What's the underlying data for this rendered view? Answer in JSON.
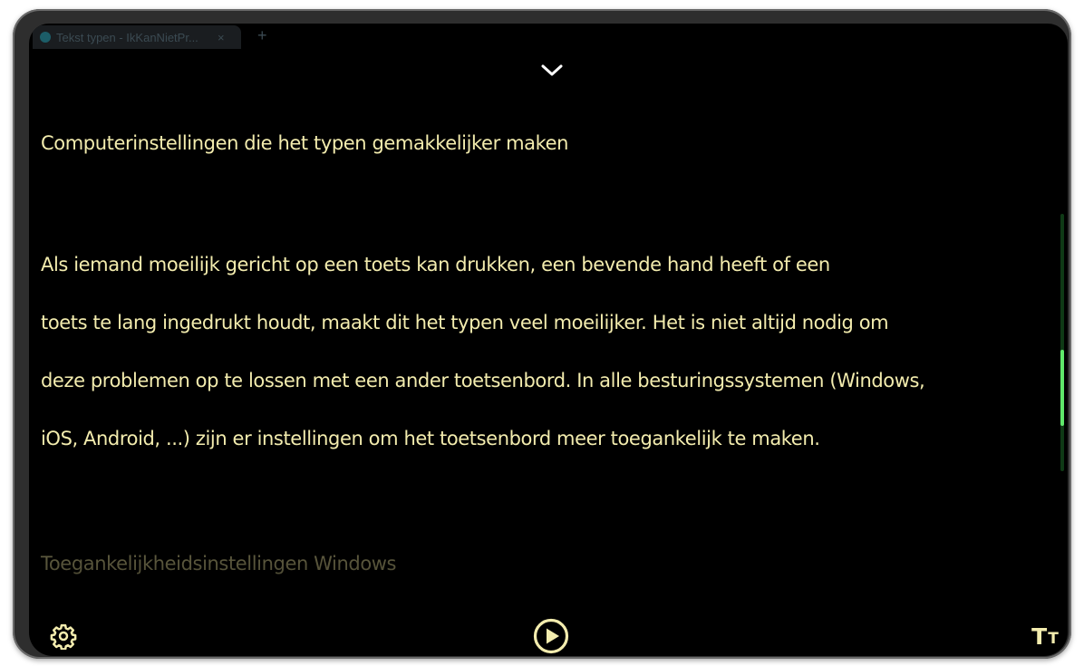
{
  "browser": {
    "tab_title": "Tekst typen - IkKanNietPr...",
    "tab_close": "×",
    "new_tab": "+"
  },
  "reader": {
    "collapse_icon": "chevron-down-icon",
    "heading": "Computerinstellingen die het typen gemakkelijker maken",
    "paragraph_lines": [
      "Als iemand moeilijk gericht op een toets kan drukken, een bevende hand heeft of een",
      "toets te lang ingedrukt houdt, maakt dit het typen veel moeilijker. Het is niet altijd nodig om",
      "deze problemen op te lossen met een ander toetsenbord. In alle besturingssystemen (Windows,",
      "iOS, Android, ...) zijn er instellingen om het toetsenbord meer toegankelijk te maken."
    ],
    "next_heading": "Toegankelijkheidsinstellingen Windows"
  },
  "controls": {
    "settings_icon": "gear-icon",
    "play_icon": "play-icon",
    "text_size_big": "T",
    "text_size_small": "T"
  },
  "scroll": {
    "position": 0.75
  },
  "colors": {
    "text": "#f3ecae",
    "background": "#000000",
    "accent": "#5fe86a"
  }
}
